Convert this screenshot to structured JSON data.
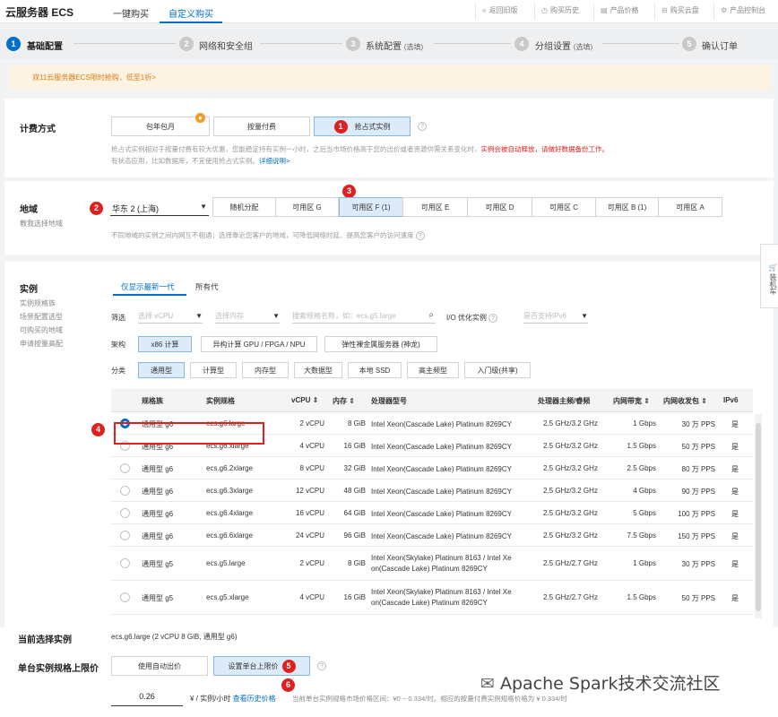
{
  "header": {
    "brand": "云服务器 ECS",
    "tabs": [
      {
        "label": "一键购买"
      },
      {
        "label": "自定义购买"
      }
    ],
    "links": [
      {
        "icon": "«",
        "label": "返回旧版"
      },
      {
        "icon": "◷",
        "label": "购买历史"
      },
      {
        "icon": "▤",
        "label": "产品价格"
      },
      {
        "icon": "⊟",
        "label": "购买云盘"
      },
      {
        "icon": "⚙",
        "label": "产品控制台"
      }
    ]
  },
  "steps": [
    {
      "num": "1",
      "label": "基础配置",
      "opt": ""
    },
    {
      "num": "2",
      "label": "网络和安全组",
      "opt": ""
    },
    {
      "num": "3",
      "label": "系统配置",
      "opt": "(选填)"
    },
    {
      "num": "4",
      "label": "分组设置",
      "opt": "(选填)"
    },
    {
      "num": "5",
      "label": "确认订单",
      "opt": ""
    }
  ],
  "promo": "双11云服务器ECS限时抢购，低至1折>",
  "billing": {
    "title": "计费方式",
    "options": [
      "包年包月",
      "按量付费",
      "抢占式实例"
    ],
    "badge": "1",
    "note1": "抢占式实例相对于按量付费有较大优惠，您能稳定持有实例一小时，之后当市场价格高于您的出价或者资源供需关系变化时，",
    "note1_red": "实例会被自动释放，请做好数据备份工作。",
    "note2": "有状态应用，比如数据库，不宜使用抢占式实例。",
    "note2_link": "详细说明>"
  },
  "region": {
    "title": "地域",
    "sub": "教我选择地域",
    "badge_select": "2",
    "badge_zone": "3",
    "selected": "华东 2 (上海)",
    "zones": [
      "随机分配",
      "可用区 G",
      "可用区 F (1)",
      "可用区 E",
      "可用区 D",
      "可用区 C",
      "可用区 B (1)",
      "可用区 A"
    ],
    "note": "不同地域的实例之间内网互不相通；选择靠近您客户的地域，可降低网络时延、提高您客户的访问速度"
  },
  "instance": {
    "title": "实例",
    "sub": [
      "实例规格族",
      "场景配置选型",
      "可购买的地域",
      "申请按量高配"
    ],
    "gen_tabs": [
      "仅显示最新一代",
      "所有代"
    ],
    "filter_label": "筛选",
    "filter_vcpu": "选择 vCPU",
    "filter_mem": "选择内存",
    "filter_search": "搜索规格名称，如：ecs.g5.large",
    "io_label": "I/O 优化实例",
    "ipv6_select": "是否支持IPv6",
    "arch_label": "架构",
    "archs": [
      "x86 计算",
      "异构计算 GPU / FPGA / NPU",
      "弹性裸金属服务器 (神龙)"
    ],
    "cat_label": "分类",
    "cats": [
      "通用型",
      "计算型",
      "内存型",
      "大数据型",
      "本地 SSD",
      "高主频型",
      "入门级(共享)"
    ],
    "badge_row": "4",
    "columns": [
      "规格族",
      "实例规格",
      "vCPU ⇕",
      "内存 ⇕",
      "处理器型号",
      "处理器主频/睿频",
      "内网带宽 ⇕",
      "内网收发包 ⇕",
      "IPv6"
    ],
    "rows": [
      {
        "family": "通用型 g6",
        "spec": "ecs.g6.large",
        "vcpu": "2 vCPU",
        "mem": "8 GiB",
        "cpu1": "Intel Xeon(Cascade Lake) Platinum 8269CY",
        "cpu2": "",
        "freq": "2.5 GHz/3.2 GHz",
        "bw": "1 Gbps",
        "pps": "30 万 PPS",
        "ipv6": "是"
      },
      {
        "family": "通用型 g6",
        "spec": "ecs.g6.xlarge",
        "vcpu": "4 vCPU",
        "mem": "16 GiB",
        "cpu1": "Intel Xeon(Cascade Lake) Platinum 8269CY",
        "cpu2": "",
        "freq": "2.5 GHz/3.2 GHz",
        "bw": "1.5 Gbps",
        "pps": "50 万 PPS",
        "ipv6": "是"
      },
      {
        "family": "通用型 g6",
        "spec": "ecs.g6.2xlarge",
        "vcpu": "8 vCPU",
        "mem": "32 GiB",
        "cpu1": "Intel Xeon(Cascade Lake) Platinum 8269CY",
        "cpu2": "",
        "freq": "2.5 GHz/3.2 GHz",
        "bw": "2.5 Gbps",
        "pps": "80 万 PPS",
        "ipv6": "是"
      },
      {
        "family": "通用型 g6",
        "spec": "ecs.g6.3xlarge",
        "vcpu": "12 vCPU",
        "mem": "48 GiB",
        "cpu1": "Intel Xeon(Cascade Lake) Platinum 8269CY",
        "cpu2": "",
        "freq": "2.5 GHz/3.2 GHz",
        "bw": "4 Gbps",
        "pps": "90 万 PPS",
        "ipv6": "是"
      },
      {
        "family": "通用型 g6",
        "spec": "ecs.g6.4xlarge",
        "vcpu": "16 vCPU",
        "mem": "64 GiB",
        "cpu1": "Intel Xeon(Cascade Lake) Platinum 8269CY",
        "cpu2": "",
        "freq": "2.5 GHz/3.2 GHz",
        "bw": "5 Gbps",
        "pps": "100 万 PPS",
        "ipv6": "是"
      },
      {
        "family": "通用型 g6",
        "spec": "ecs.g6.6xlarge",
        "vcpu": "24 vCPU",
        "mem": "96 GiB",
        "cpu1": "Intel Xeon(Cascade Lake) Platinum 8269CY",
        "cpu2": "",
        "freq": "2.5 GHz/3.2 GHz",
        "bw": "7.5 Gbps",
        "pps": "150 万 PPS",
        "ipv6": "是"
      },
      {
        "family": "通用型 g5",
        "spec": "ecs.g5.large",
        "vcpu": "2 vCPU",
        "mem": "8 GiB",
        "cpu1": "Intel Xeon(Skylake) Platinum 8163 / Intel Xe",
        "cpu2": "on(Cascade Lake) Platinum 8269CY",
        "freq": "2.5 GHz/2.7 GHz",
        "bw": "1 Gbps",
        "pps": "30 万 PPS",
        "ipv6": "是"
      },
      {
        "family": "通用型 g5",
        "spec": "ecs.g5.xlarge",
        "vcpu": "4 vCPU",
        "mem": "16 GiB",
        "cpu1": "Intel Xeon(Skylake) Platinum 8163 / Intel Xe",
        "cpu2": "on(Cascade Lake) Platinum 8269CY",
        "freq": "2.5 GHz/2.7 GHz",
        "bw": "1.5 Gbps",
        "pps": "50 万 PPS",
        "ipv6": "是"
      }
    ]
  },
  "current": {
    "label": "当前选择实例",
    "value": "ecs.g6.large (2 vCPU 8 GiB, 通用型 g6)"
  },
  "price_limit": {
    "label": "单台实例规格上限价",
    "options": [
      "使用自动出价",
      "设置单台上限价"
    ],
    "badge_btn": "5",
    "badge_input": "6",
    "input_value": "0.26",
    "unit": "¥ / 实例/小时",
    "history_link": "查看历史价格",
    "range_note": "当前单台实例规格市场价格区间：¥0 ~ 0.334/时。相应的按量付费实例规格价格为 ¥ 0.334/时"
  },
  "cart": "装机车",
  "watermark": "Apache Spark技术交流社区"
}
